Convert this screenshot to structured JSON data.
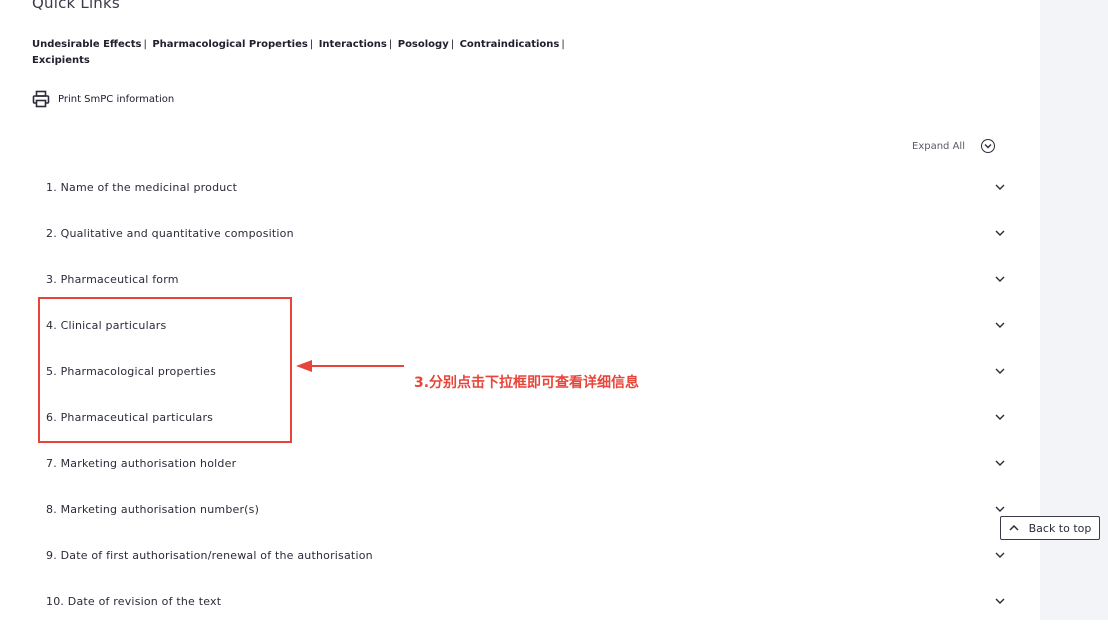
{
  "quick_links": {
    "title": "Quick Links",
    "links": [
      "Undesirable Effects",
      "Pharmacological Properties",
      "Interactions",
      "Posology",
      "Contraindications",
      "Excipients"
    ],
    "separator": "|"
  },
  "print": {
    "label": "Print SmPC information",
    "icon": "printer-icon"
  },
  "expand_all": {
    "label": "Expand All",
    "icon": "chevron-down-circle-icon"
  },
  "sections": [
    "1. Name of the medicinal product",
    "2. Qualitative and quantitative composition",
    "3. Pharmaceutical form",
    "4. Clinical particulars",
    "5. Pharmacological properties",
    "6. Pharmaceutical particulars",
    "7. Marketing authorisation holder",
    "8. Marketing authorisation number(s)",
    "9. Date of first authorisation/renewal of the authorisation",
    "10. Date of revision of the text"
  ],
  "annotation": {
    "text": "3.分别点击下拉框即可查看详细信息",
    "color": "#e8443a"
  },
  "back_to_top": {
    "label": "Back to top",
    "icon": "chevron-up-icon"
  }
}
